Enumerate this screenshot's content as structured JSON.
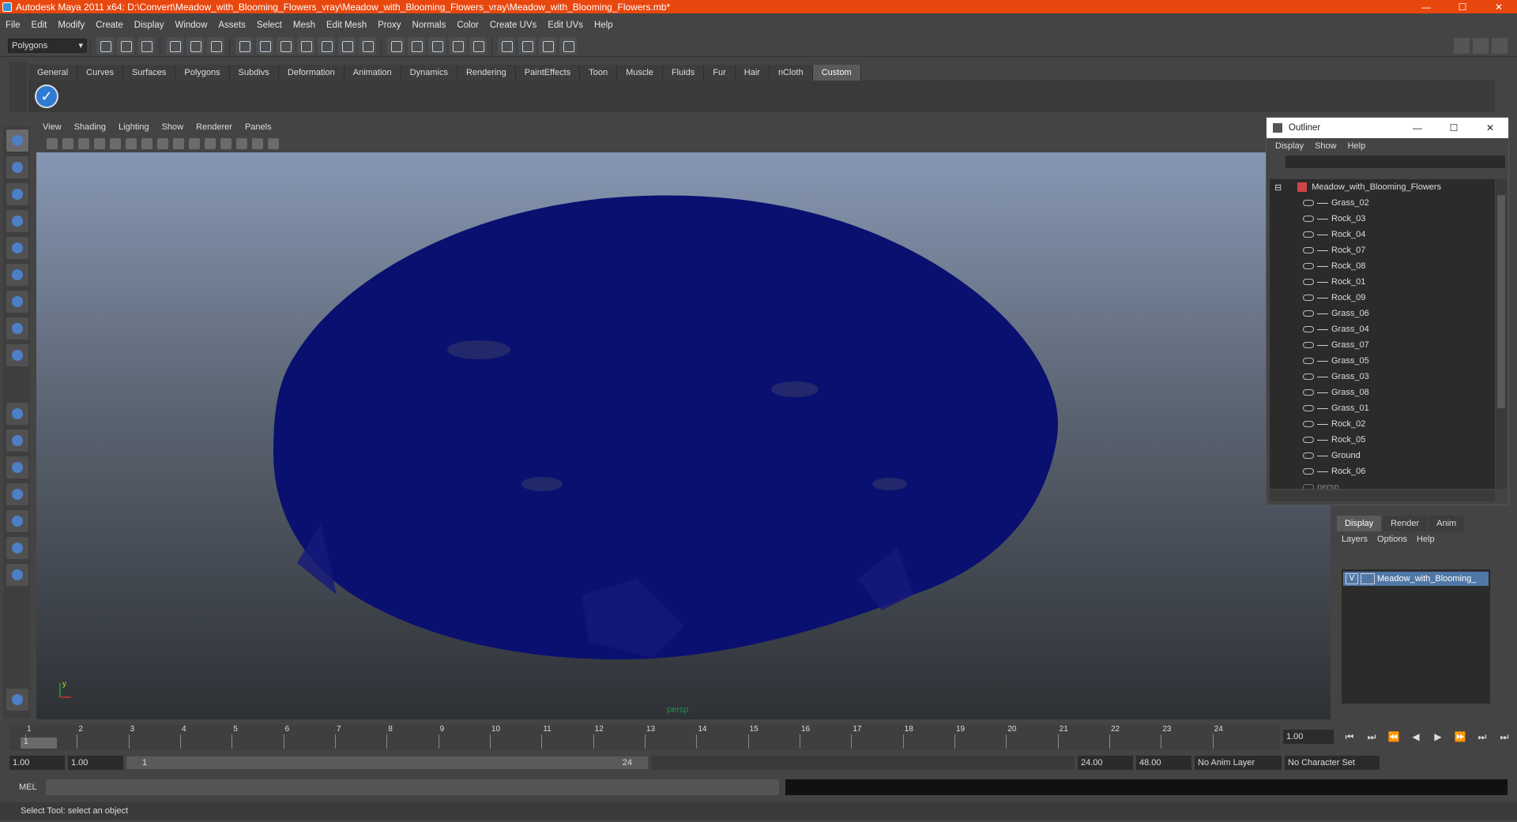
{
  "window": {
    "title": "Autodesk Maya 2011 x64: D:\\Convert\\Meadow_with_Blooming_Flowers_vray\\Meadow_with_Blooming_Flowers_vray\\Meadow_with_Blooming_Flowers.mb*",
    "minimize": "—",
    "maximize": "☐",
    "close": "✕"
  },
  "menu": [
    "File",
    "Edit",
    "Modify",
    "Create",
    "Display",
    "Window",
    "Assets",
    "Select",
    "Mesh",
    "Edit Mesh",
    "Proxy",
    "Normals",
    "Color",
    "Create UVs",
    "Edit UVs",
    "Help"
  ],
  "mode_selector": "Polygons",
  "shelf": {
    "tabs": [
      "General",
      "Curves",
      "Surfaces",
      "Polygons",
      "Subdivs",
      "Deformation",
      "Animation",
      "Dynamics",
      "Rendering",
      "PaintEffects",
      "Toon",
      "Muscle",
      "Fluids",
      "Fur",
      "Hair",
      "nCloth",
      "Custom"
    ],
    "active_tab": "Custom",
    "button_icon": "check-icon"
  },
  "viewport": {
    "menu": [
      "View",
      "Shading",
      "Lighting",
      "Show",
      "Renderer",
      "Panels"
    ],
    "camera_label": "persp",
    "wire_color": "#0a1070",
    "axis_y": "y",
    "axis_x": "x"
  },
  "outliner": {
    "title": "Outliner",
    "menu": [
      "Display",
      "Show",
      "Help"
    ],
    "root": "Meadow_with_Blooming_Flowers",
    "items": [
      "Grass_02",
      "Rock_03",
      "Rock_04",
      "Rock_07",
      "Rock_08",
      "Rock_01",
      "Rock_09",
      "Grass_06",
      "Grass_04",
      "Grass_07",
      "Grass_05",
      "Grass_03",
      "Grass_08",
      "Grass_01",
      "Rock_02",
      "Rock_05",
      "Ground",
      "Rock_06"
    ],
    "partial_item": "persp"
  },
  "layers": {
    "tabs": [
      "Display",
      "Render",
      "Anim"
    ],
    "active_tab": "Display",
    "menu": [
      "Layers",
      "Options",
      "Help"
    ],
    "layer": {
      "visibility": "V",
      "name": "Meadow_with_Blooming_"
    }
  },
  "timeline": {
    "ticks": [
      "1",
      "2",
      "3",
      "4",
      "5",
      "6",
      "7",
      "8",
      "9",
      "10",
      "11",
      "12",
      "13",
      "14",
      "15",
      "16",
      "17",
      "18",
      "19",
      "20",
      "21",
      "22",
      "23",
      "24"
    ],
    "current_frame_marker": "1",
    "current_frame": "1.00",
    "play_controls": [
      "⏮",
      "⏭",
      "⏪",
      "◀",
      "▶",
      "⏩",
      "⏭",
      "⏭"
    ]
  },
  "range": {
    "start": "1.00",
    "playback_start": "1.00",
    "slider_left": "1",
    "slider_right": "24",
    "playback_end": "24.00",
    "end": "48.00",
    "anim_layer": "No Anim Layer",
    "character_set": "No Character Set"
  },
  "command": {
    "label": "MEL"
  },
  "help_line": "Select Tool: select an object"
}
